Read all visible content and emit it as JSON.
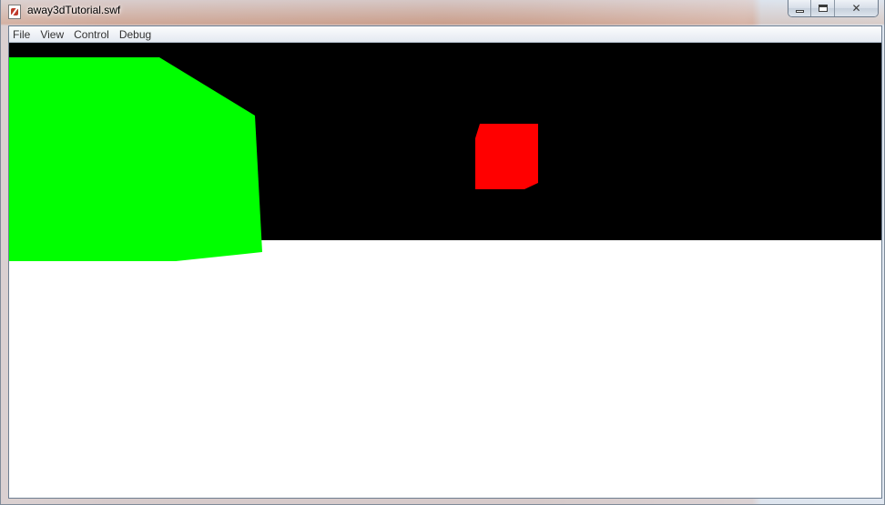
{
  "window": {
    "title": "away3dTutorial.swf",
    "icon": "flash-player-icon"
  },
  "caption_buttons": {
    "minimize_icon": "minimize-icon",
    "maximize_icon": "maximize-icon",
    "close_glyph": "✕"
  },
  "menu": {
    "items": [
      {
        "label": "File"
      },
      {
        "label": "View"
      },
      {
        "label": "Control"
      },
      {
        "label": "Debug"
      }
    ]
  },
  "scene": {
    "background_color": "#000000",
    "floor_color": "#ffffff",
    "objects": [
      {
        "name": "green-cube",
        "color": "#00ff00"
      },
      {
        "name": "red-cube",
        "color": "#ff0000"
      }
    ]
  }
}
